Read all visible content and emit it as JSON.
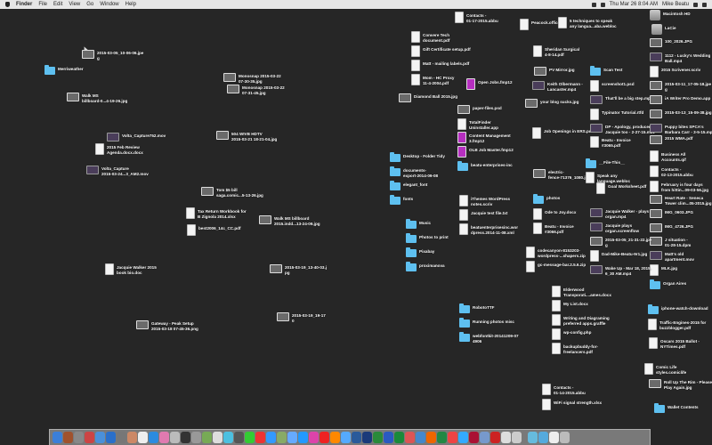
{
  "menubar": {
    "menus": [
      "Finder",
      "File",
      "Edit",
      "View",
      "Go",
      "Window",
      "Help"
    ],
    "datetime": "Thu Mar 26  8:04 AM",
    "user": "Mike Beatu"
  },
  "desktop": {
    "items": [
      {
        "label": "2015-03-05_10-06-06.jpe\ng",
        "kind": "i"
      },
      {
        "label": "Merriweather",
        "kind": "f"
      },
      {
        "label": "Walk MS\nbillboard-0...4-19-26.jpg",
        "kind": "i"
      },
      {
        "label": "Monosnap 2015-03-22\n07-30-35.jpg",
        "kind": "i"
      },
      {
        "label": "Monosnap 2015-03-22\n07-31-45.jpg",
        "kind": "i"
      },
      {
        "label": "Volta_Capture752.mov",
        "kind": "v"
      },
      {
        "label": "2015 Feb Review\nAgenda.docx.docx",
        "kind": "d"
      },
      {
        "label": "Volta_Capture\n2015-03-24...3_AM2.mov",
        "kind": "v"
      },
      {
        "label": "504 WIVB HDTV\n2015-03-21 18-21-04.jpg",
        "kind": "i"
      },
      {
        "label": "Tom $5 bill\nsaga.comic...5-13-26.jpg",
        "kind": "i"
      },
      {
        "label": "Tax Return Workbook for\nB Zignola 2014.xlsx",
        "kind": "d"
      },
      {
        "label": "best2006_14c_CC.pdf",
        "kind": "d"
      },
      {
        "label": "Walk MS billboard\n2015.indd...13-24-09.jpg",
        "kind": "i"
      },
      {
        "label": "Jacquie Walker 2015\nbook bio.doc",
        "kind": "d"
      },
      {
        "label": "2015-03-19_13-40-03.j\npg",
        "kind": "i"
      },
      {
        "label": "2015-03-19_19-17\n0",
        "kind": "i"
      },
      {
        "label": "Gateway - Peak Setup\n2015-03-18 07-45-36.png",
        "kind": "i"
      },
      {
        "label": "Contacts -\n01-17-2015.abbu",
        "kind": "d"
      },
      {
        "label": "Peacock.office",
        "kind": "d"
      },
      {
        "label": "5 techniques to speak\nany langua...aba.webloc",
        "kind": "d"
      },
      {
        "label": "Macintosh HD",
        "kind": "h"
      },
      {
        "label": "LaCie",
        "kind": "h"
      },
      {
        "label": "Convere Tech\ndocument.pdf",
        "kind": "d"
      },
      {
        "label": "Gift Certificate setup.pdf",
        "kind": "d"
      },
      {
        "label": "Matt - mailing labels.pdf",
        "kind": "d"
      },
      {
        "label": "Mom - HC Proxy\n11-4-2004.pdf",
        "kind": "d"
      },
      {
        "label": "Open Jobs.fmp12",
        "kind": "p"
      },
      {
        "label": "Diamond Ball 2015.jpg",
        "kind": "i"
      },
      {
        "label": "paper-files.psd",
        "kind": "i"
      },
      {
        "label": "Sheridan Surgical\n4-8-14.pdf",
        "kind": "d"
      },
      {
        "label": "PV Mirror.jpg",
        "kind": "i"
      },
      {
        "label": "Keith Olbermann -\nLancaster.mp4",
        "kind": "v"
      },
      {
        "label": "your blog sucks.jpg",
        "kind": "i"
      },
      {
        "label": "Scan Test",
        "kind": "f"
      },
      {
        "label": "screenshot1.psd",
        "kind": "d"
      },
      {
        "label": "That'll be a big step.mp4",
        "kind": "v"
      },
      {
        "label": "Typinator Tutorial.rtfd",
        "kind": "d"
      },
      {
        "label": "100_2026.JPG",
        "kind": "i"
      },
      {
        "label": "1112 - Lucky's Wedding\nBall.mp4",
        "kind": "v"
      },
      {
        "label": "2015 Scrivener.scriv",
        "kind": "d"
      },
      {
        "label": "2015-03-11_17-05-18.jpe\ng",
        "kind": "i"
      },
      {
        "label": "iA Writer Pro Demo.app",
        "kind": "i"
      },
      {
        "label": "2015-03-13_15-09-38.jpg",
        "kind": "i"
      },
      {
        "label": "TotalFinder\nUninstaller.app",
        "kind": "d"
      },
      {
        "label": "Content Management\n3.fmp12",
        "kind": "p"
      },
      {
        "label": "OLB Job Master.fmp12",
        "kind": "p"
      },
      {
        "label": "beatu-enterprises-inc",
        "kind": "f"
      },
      {
        "label": "Job Openings in ERS.pdf",
        "kind": "d"
      },
      {
        "label": "DP - Apology, producer,\nJacquie too - 2-27-15.m4v",
        "kind": "v"
      },
      {
        "label": "Beatu - Invoice\n#3065.pdf",
        "kind": "d"
      },
      {
        "label": "Puppy bites SPCA's\nBarbara Carr - 3-5-15.mp4",
        "kind": "v"
      },
      {
        "label": "2015 WMA.pdf",
        "kind": "i"
      },
      {
        "label": "Business All\nAccounts.qif",
        "kind": "d"
      },
      {
        "label": "Contacts -\n02-13-2015.abbu",
        "kind": "d"
      },
      {
        "label": "February is four days\nfrom hittin...09-03-56.jpg",
        "kind": "d"
      },
      {
        "label": "Heart Rate - Seneca\nTower clim...05-2015.jpg",
        "kind": "i"
      },
      {
        "label": "IMG_0603.JPG",
        "kind": "i"
      },
      {
        "label": "IMG_4726.JPG",
        "kind": "i"
      },
      {
        "label": "J situation -\n01-28-15.dpm",
        "kind": "i"
      },
      {
        "label": "Matt's old\napartment.mov",
        "kind": "v"
      },
      {
        "label": "MLK.jpg",
        "kind": "d"
      },
      {
        "label": "Organ Aires",
        "kind": "f"
      },
      {
        "label": "Desktop - Folder Tidy",
        "kind": "f"
      },
      {
        "label": "documents-\nexport-2014-09-08",
        "kind": "f"
      },
      {
        "label": "elegant_font",
        "kind": "f"
      },
      {
        "label": "fonts",
        "kind": "f"
      },
      {
        "label": "__File-This__",
        "kind": "f"
      },
      {
        "label": "electric-\nfence-71376_1080.jpg",
        "kind": "i"
      },
      {
        "label": "Speak any\nlanguage.webloc",
        "kind": "d"
      },
      {
        "label": "Goal Worksheet.pdf",
        "kind": "d"
      },
      {
        "label": "iThemes WordPress\nnotes.scriv",
        "kind": "d"
      },
      {
        "label": "Jacquie test file.txt",
        "kind": "d"
      },
      {
        "label": "beatuenterprisesinc.wor\ndpress.2014-11-08.xml",
        "kind": "d"
      },
      {
        "label": "photos",
        "kind": "f"
      },
      {
        "label": "Ode to Joy.docx",
        "kind": "d"
      },
      {
        "label": "Beatu - Invoice\n#3066.pdf",
        "kind": "d"
      },
      {
        "label": "Jacquie Walker - plays\norgan.mp4",
        "kind": "v"
      },
      {
        "label": "Jacquie plays\norgan.screenflow",
        "kind": "v"
      },
      {
        "label": "2015-03-05_21-31-22.jpe\ng",
        "kind": "i"
      },
      {
        "label": "Dad-Mike-Beatu-9r1.jpg",
        "kind": "d"
      },
      {
        "label": "Wake Up - Mar 18, 2015,\n6_30 AM.mp4",
        "kind": "v"
      },
      {
        "label": "Music",
        "kind": "f"
      },
      {
        "label": "Photos to print",
        "kind": "f"
      },
      {
        "label": "Pixabay",
        "kind": "f"
      },
      {
        "label": "proximanova",
        "kind": "f"
      },
      {
        "label": "codecanyon-8153203-\nwordpress-...shapers.zip",
        "kind": "d"
      },
      {
        "label": "gc-message-bar.2.5.6.zip",
        "kind": "d"
      },
      {
        "label": "Elderwood\nTransporati....ames.docx",
        "kind": "d"
      },
      {
        "label": "My List.docx",
        "kind": "d"
      },
      {
        "label": "Writing and Diagraming\npreferred apps.graffle",
        "kind": "d"
      },
      {
        "label": "wp-config.php",
        "kind": "d"
      },
      {
        "label": "backupbuddy-for-\nfreelancers.pdf",
        "kind": "d"
      },
      {
        "label": "RobotoTTF",
        "kind": "f"
      },
      {
        "label": "Running photos misc",
        "kind": "f"
      },
      {
        "label": "webfontkit-20141209-07\n4906",
        "kind": "f"
      },
      {
        "label": "iphone-watch-download",
        "kind": "f"
      },
      {
        "label": "Traffic-Engines-2015 for\nbuzzblogger.pdf",
        "kind": "d"
      },
      {
        "label": "Oscars 2015 Ballot -\nNYTimes.pdf",
        "kind": "d"
      },
      {
        "label": "Comic Life\nstyles.comiclife",
        "kind": "d"
      },
      {
        "label": "Roll Up The Rim - Please\nPlay Again.jpg",
        "kind": "i"
      },
      {
        "label": "Contacts -\n01-14-2015.abbu",
        "kind": "d"
      },
      {
        "label": "WiFi signal strength.xlsx",
        "kind": "d"
      },
      {
        "label": "Wallet Contents",
        "kind": "f"
      }
    ]
  },
  "dock": {
    "colors": [
      "#3b7fd9",
      "#a0522d",
      "#888",
      "#c44",
      "#4a90d9",
      "#2a6fc9",
      "#777",
      "#c86",
      "#eee",
      "#2b8be0",
      "#e07ab0",
      "#bbb",
      "#333",
      "#999",
      "#7a5",
      "#ddd",
      "#4cc0e0",
      "#555",
      "#3c3",
      "#e33",
      "#39f",
      "#8a6",
      "#6af",
      "#29f",
      "#d4a",
      "#e22",
      "#f80",
      "#5af",
      "#2a5a9a",
      "#1a3a7a",
      "#2a8a3a",
      "#2a5ac0",
      "#1a8a3a",
      "#d55",
      "#48c",
      "#e60",
      "#284",
      "#e44",
      "#3af",
      "#a13",
      "#79c",
      "#c22",
      "#ddd",
      "#ccc",
      "#6bd",
      "#5ad",
      "#eee",
      "#bbb"
    ]
  }
}
